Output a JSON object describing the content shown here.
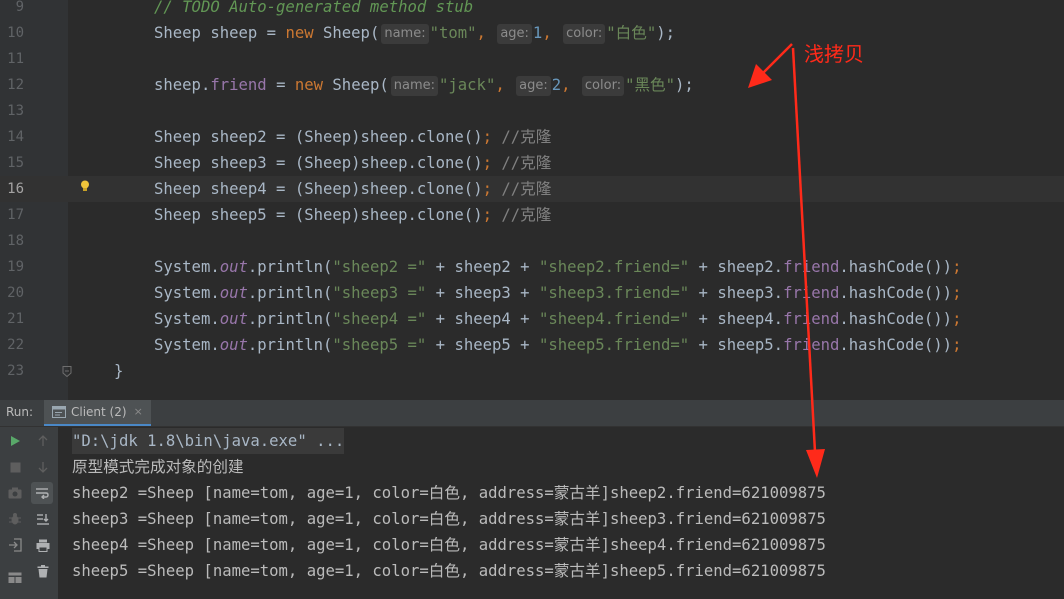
{
  "editor": {
    "line_numbers": [
      "9",
      "10",
      "11",
      "12",
      "13",
      "14",
      "15",
      "16",
      "17",
      "18",
      "19",
      "20",
      "21",
      "22",
      "23"
    ],
    "line9": {
      "comment": "// TODO Auto-generated method stub"
    },
    "line10": {
      "t1": "Sheep sheep = ",
      "new": "new",
      "t2": " Sheep(",
      "hint_name": "name:",
      "str_name": "\"tom\"",
      "c1": ", ",
      "hint_age": "age:",
      "num_age": "1",
      "c2": ", ",
      "hint_color": "color:",
      "str_color": "\"白色\"",
      "end": ");"
    },
    "line12": {
      "t1": "sheep.",
      "field": "friend",
      "t2": " = ",
      "new": "new",
      "t3": " Sheep(",
      "hint_name": "name:",
      "str_name": "\"jack\"",
      "c1": ", ",
      "hint_age": "age:",
      "num_age": "2",
      "c2": ", ",
      "hint_color": "color:",
      "str_color": "\"黑色\"",
      "end": ");"
    },
    "clone_lines": [
      {
        "code": "Sheep sheep2 = (Sheep)sheep.clone()",
        "semi": ";",
        "comment": " //克隆"
      },
      {
        "code": "Sheep sheep3 = (Sheep)sheep.clone()",
        "semi": ";",
        "comment": " //克隆"
      },
      {
        "code": "Sheep sheep4 = (Sheep)sheep.clone()",
        "semi": ";",
        "comment": " //克隆"
      },
      {
        "code": "Sheep sheep5 = (Sheep)sheep.clone()",
        "semi": ";",
        "comment": " //克隆"
      }
    ],
    "print_lines": [
      {
        "sys": "System.",
        "out": "out",
        "p1": ".println(",
        "s1": "\"sheep2 =\"",
        "p2": " + sheep2 + ",
        "s2": "\"sheep2.friend=\"",
        "p3": " + sheep2.",
        "fr": "friend",
        "p4": ".hashCode())",
        "semi": ";"
      },
      {
        "sys": "System.",
        "out": "out",
        "p1": ".println(",
        "s1": "\"sheep3 =\"",
        "p2": " + sheep3 + ",
        "s2": "\"sheep3.friend=\"",
        "p3": " + sheep3.",
        "fr": "friend",
        "p4": ".hashCode())",
        "semi": ";"
      },
      {
        "sys": "System.",
        "out": "out",
        "p1": ".println(",
        "s1": "\"sheep4 =\"",
        "p2": " + sheep4 + ",
        "s2": "\"sheep4.friend=\"",
        "p3": " + sheep4.",
        "fr": "friend",
        "p4": ".hashCode())",
        "semi": ";"
      },
      {
        "sys": "System.",
        "out": "out",
        "p1": ".println(",
        "s1": "\"sheep5 =\"",
        "p2": " + sheep5 + ",
        "s2": "\"sheep5.friend=\"",
        "p3": " + sheep5.",
        "fr": "friend",
        "p4": ".hashCode())",
        "semi": ";"
      }
    ],
    "line23": {
      "brace": "}"
    }
  },
  "run_panel": {
    "label": "Run:",
    "tab_label": "Client (2)",
    "tab_close": "×",
    "console": [
      "\"D:\\jdk 1.8\\bin\\java.exe\" ...",
      "原型模式完成对象的创建",
      "sheep2 =Sheep [name=tom, age=1, color=白色, address=蒙古羊]sheep2.friend=621009875",
      "sheep3 =Sheep [name=tom, age=1, color=白色, address=蒙古羊]sheep3.friend=621009875",
      "sheep4 =Sheep [name=tom, age=1, color=白色, address=蒙古羊]sheep4.friend=621009875",
      "sheep5 =Sheep [name=tom, age=1, color=白色, address=蒙古羊]sheep5.friend=621009875"
    ]
  },
  "annotation": {
    "text": "浅拷贝",
    "color": "#ff2a1a"
  },
  "icons": [
    "lightbulb-icon",
    "fold-icon",
    "console-icon",
    "rerun-icon",
    "stop-icon",
    "screenshot-icon",
    "debug-icon",
    "exit-icon",
    "layout-icon",
    "up-arrow-icon",
    "down-arrow-icon",
    "soft-wrap-icon",
    "scroll-to-end-icon",
    "print-icon",
    "trash-icon"
  ]
}
